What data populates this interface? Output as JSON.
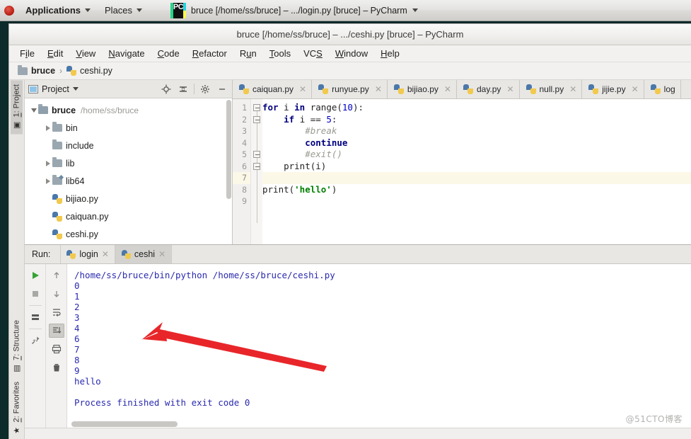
{
  "gnome": {
    "applications": "Applications",
    "places": "Places",
    "window_title": "bruce [/home/ss/bruce] – .../login.py [bruce] – PyCharm",
    "pc_icon_text": "PC"
  },
  "window": {
    "title": "bruce [/home/ss/bruce] – .../ceshi.py [bruce] – PyCharm"
  },
  "menu": {
    "items": [
      {
        "pre": "F",
        "mn": "i",
        "post": "le"
      },
      {
        "pre": "",
        "mn": "E",
        "post": "dit"
      },
      {
        "pre": "",
        "mn": "V",
        "post": "iew"
      },
      {
        "pre": "",
        "mn": "N",
        "post": "avigate"
      },
      {
        "pre": "",
        "mn": "C",
        "post": "ode"
      },
      {
        "pre": "",
        "mn": "R",
        "post": "efactor"
      },
      {
        "pre": "R",
        "mn": "u",
        "post": "n"
      },
      {
        "pre": "",
        "mn": "T",
        "post": "ools"
      },
      {
        "pre": "VC",
        "mn": "S",
        "post": ""
      },
      {
        "pre": "",
        "mn": "W",
        "post": "indow"
      },
      {
        "pre": "",
        "mn": "H",
        "post": "elp"
      }
    ]
  },
  "breadcrumb": {
    "project": "bruce",
    "separator": "›",
    "file": "ceshi.py"
  },
  "left_tool_tabs": [
    {
      "num": "1",
      "label": ": Project",
      "active": true
    },
    {
      "num": "7",
      "label": ": Structure",
      "active": false
    },
    {
      "num": "2",
      "label": ": Favorites",
      "active": false
    }
  ],
  "project_panel": {
    "title": "Project",
    "toolbar": [
      "locate-icon",
      "collapse-all-icon",
      "gear-icon",
      "minimize-icon"
    ],
    "tree": [
      {
        "label": "bruce",
        "path": "/home/ss/bruce",
        "indent": 0,
        "twisty": "open",
        "icon": "folder",
        "bold": true
      },
      {
        "label": "bin",
        "path": "",
        "indent": 1,
        "twisty": "closed",
        "icon": "folder",
        "bold": false
      },
      {
        "label": "include",
        "path": "",
        "indent": 1,
        "twisty": "none",
        "icon": "folder",
        "bold": false
      },
      {
        "label": "lib",
        "path": "",
        "indent": 1,
        "twisty": "closed",
        "icon": "folder",
        "bold": false
      },
      {
        "label": "lib64",
        "path": "",
        "indent": 1,
        "twisty": "closed",
        "icon": "folder-link",
        "bold": false
      },
      {
        "label": "bijiao.py",
        "path": "",
        "indent": 1,
        "twisty": "none",
        "icon": "py",
        "bold": false
      },
      {
        "label": "caiquan.py",
        "path": "",
        "indent": 1,
        "twisty": "none",
        "icon": "py",
        "bold": false
      },
      {
        "label": "ceshi.py",
        "path": "",
        "indent": 1,
        "twisty": "none",
        "icon": "py",
        "bold": false
      }
    ]
  },
  "editor_tabs": [
    {
      "label": "caiquan.py"
    },
    {
      "label": "runyue.py"
    },
    {
      "label": "bijiao.py"
    },
    {
      "label": "day.py"
    },
    {
      "label": "null.py"
    },
    {
      "label": "jijie.py"
    },
    {
      "label": "log"
    }
  ],
  "editor": {
    "line_numbers": [
      "1",
      "2",
      "3",
      "4",
      "5",
      "6",
      "7",
      "8",
      "9"
    ],
    "current_line": 7,
    "lines": [
      {
        "n": 1,
        "tokens": [
          {
            "t": "kw",
            "v": "for"
          },
          {
            "t": "fn",
            "v": " i "
          },
          {
            "t": "kw",
            "v": "in"
          },
          {
            "t": "fn",
            "v": " range("
          },
          {
            "t": "num",
            "v": "10"
          },
          {
            "t": "fn",
            "v": "):"
          }
        ]
      },
      {
        "n": 2,
        "tokens": [
          {
            "t": "fn",
            "v": "    "
          },
          {
            "t": "kw",
            "v": "if"
          },
          {
            "t": "fn",
            "v": " i == "
          },
          {
            "t": "num",
            "v": "5"
          },
          {
            "t": "fn",
            "v": ":"
          }
        ]
      },
      {
        "n": 3,
        "tokens": [
          {
            "t": "fn",
            "v": "        "
          },
          {
            "t": "cmt",
            "v": "#break"
          }
        ]
      },
      {
        "n": 4,
        "tokens": [
          {
            "t": "fn",
            "v": "        "
          },
          {
            "t": "kw",
            "v": "continue"
          }
        ]
      },
      {
        "n": 5,
        "tokens": [
          {
            "t": "fn",
            "v": "        "
          },
          {
            "t": "cmt",
            "v": "#exit()"
          }
        ]
      },
      {
        "n": 6,
        "tokens": [
          {
            "t": "fn",
            "v": "    print(i)"
          }
        ]
      },
      {
        "n": 7,
        "tokens": [
          {
            "t": "fn",
            "v": ""
          }
        ]
      },
      {
        "n": 8,
        "tokens": [
          {
            "t": "fn",
            "v": "print("
          },
          {
            "t": "str",
            "v": "'hello'"
          },
          {
            "t": "fn",
            "v": ")"
          }
        ]
      },
      {
        "n": 9,
        "tokens": [
          {
            "t": "fn",
            "v": ""
          }
        ]
      }
    ]
  },
  "run_panel": {
    "label": "Run:",
    "tabs": [
      {
        "label": "login",
        "active": false
      },
      {
        "label": "ceshi",
        "active": true
      }
    ],
    "toolbar_left": [
      "rerun-icon",
      "stop-icon",
      "console-icon",
      "pin-icon"
    ],
    "toolbar_right": [
      "up-arrow-icon",
      "down-arrow-icon",
      "soft-wrap-icon",
      "scroll-to-end-icon",
      "print-icon",
      "trash-icon"
    ],
    "console_lines": [
      "/home/ss/bruce/bin/python /home/ss/bruce/ceshi.py",
      "0",
      "1",
      "2",
      "3",
      "4",
      "6",
      "7",
      "8",
      "9",
      "hello",
      "",
      "Process finished with exit code 0"
    ]
  },
  "annotation": {
    "arrow_color": "#e8262a"
  },
  "watermark": "@51CTO博客"
}
